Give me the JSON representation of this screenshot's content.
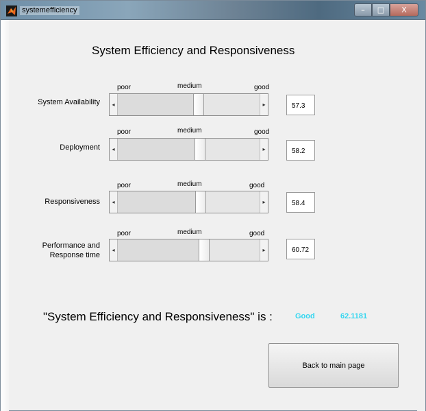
{
  "window": {
    "title": "systemefficiency",
    "controls": {
      "minimize": "–",
      "maximize": "□",
      "close": "X"
    }
  },
  "heading": "System Efficiency and Responsiveness",
  "scale_labels": {
    "poor": "poor",
    "medium": "medium",
    "good": "good"
  },
  "rows": [
    {
      "label_line1": "System Availability",
      "label_line2": "",
      "value": "57.3",
      "level_fraction": 0.573
    },
    {
      "label_line1": "Deployment",
      "label_line2": "",
      "value": "58.2",
      "level_fraction": 0.582
    },
    {
      "label_line1": "Responsiveness",
      "label_line2": "",
      "value": "58.4",
      "level_fraction": 0.584
    },
    {
      "label_line1": "Performance and",
      "label_line2": "Response time",
      "value": "60.72",
      "level_fraction": 0.6072
    }
  ],
  "result": {
    "label": "\"System Efficiency and Responsiveness\" is :",
    "status": "Good",
    "score": "62.1181",
    "accent_color": "#33d6f0"
  },
  "buttons": {
    "back": "Back to main page"
  },
  "icons": {
    "app": "matlab-icon",
    "slider_left": "arrow-left-icon",
    "slider_right": "arrow-right-icon"
  }
}
